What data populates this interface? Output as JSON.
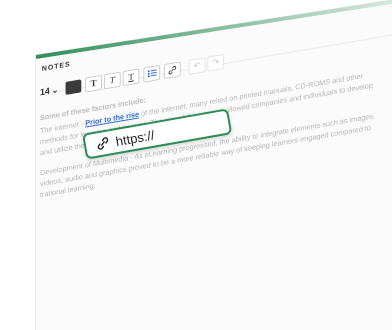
{
  "notes": {
    "label": "NOTES"
  },
  "toolbar": {
    "font_size": "14",
    "bold": "T",
    "italic": "T",
    "underline": "T"
  },
  "content": {
    "heading": "Some of these factors include:",
    "p1_pre": "The internet - ",
    "p1_link": "Prior to the rise",
    "p1_post": " of the internet, many relied on printed manuals, CD-ROMS and other methods for learning and training. The rise of the internet allowed companies and individuals to develop and utilize the flexibility of eLearning.",
    "p2": "Development of Multimedia - As eLearning progressed, the ability to integrate elements such as images, videos, audio and graphics proved to be a more reliable way of keeping learners engaged compared to trational learning."
  },
  "url_popup": {
    "value": "https://"
  },
  "colors": {
    "accent_green": "#2e8b57",
    "link_blue": "#2f6bd6"
  }
}
